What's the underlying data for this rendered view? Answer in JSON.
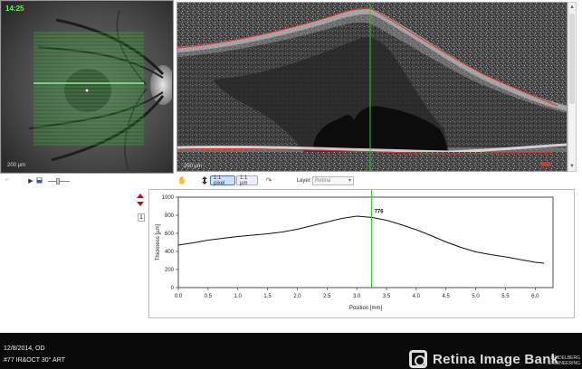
{
  "fundus": {
    "timestamp": "14:25",
    "scale_label": "200 µm"
  },
  "oct": {
    "scale_label": "200 µm",
    "scan_position_fraction": 0.49
  },
  "toolbar": {
    "pixel_button": "1:1 pixel",
    "um_button": "1:1 µm",
    "layer_label": "Layer:",
    "layer_value": "Retina"
  },
  "sidebar": {
    "page": "1"
  },
  "chart_data": {
    "type": "line",
    "xlabel": "Position [mm]",
    "ylabel": "Thickness [µm]",
    "xlim": [
      0,
      6.3
    ],
    "ylim": [
      0,
      1000
    ],
    "xticks": [
      "0.0",
      "0.5",
      "1.0",
      "1.5",
      "2.0",
      "2.5",
      "3.0",
      "3.5",
      "4.0",
      "4.5",
      "5.0",
      "5.5",
      "6.0"
    ],
    "yticks": [
      "0",
      "200",
      "400",
      "600",
      "800",
      "1000"
    ],
    "x": [
      0.0,
      0.25,
      0.5,
      0.75,
      1.0,
      1.25,
      1.5,
      1.75,
      2.0,
      2.25,
      2.5,
      2.75,
      3.0,
      3.25,
      3.5,
      3.75,
      4.0,
      4.25,
      4.5,
      4.75,
      5.0,
      5.25,
      5.5,
      5.75,
      6.0,
      6.15
    ],
    "y": [
      470,
      495,
      525,
      545,
      565,
      580,
      595,
      615,
      645,
      685,
      725,
      765,
      790,
      776,
      745,
      695,
      640,
      575,
      505,
      445,
      395,
      365,
      340,
      310,
      280,
      270
    ],
    "cursor_x": 3.25,
    "cursor_label": "776",
    "grid": false
  },
  "footer": {
    "date": "12/8/2014, OD",
    "description": "#77 IR&OCT 30° ART"
  },
  "watermark": "Retina Image Bank",
  "brand": [
    "HEIDELBERG",
    "ENGINEERING"
  ],
  "colors": {
    "scan_line": "#2ad02a",
    "boundary": "#e03030",
    "cursor": "#2ac82a"
  }
}
